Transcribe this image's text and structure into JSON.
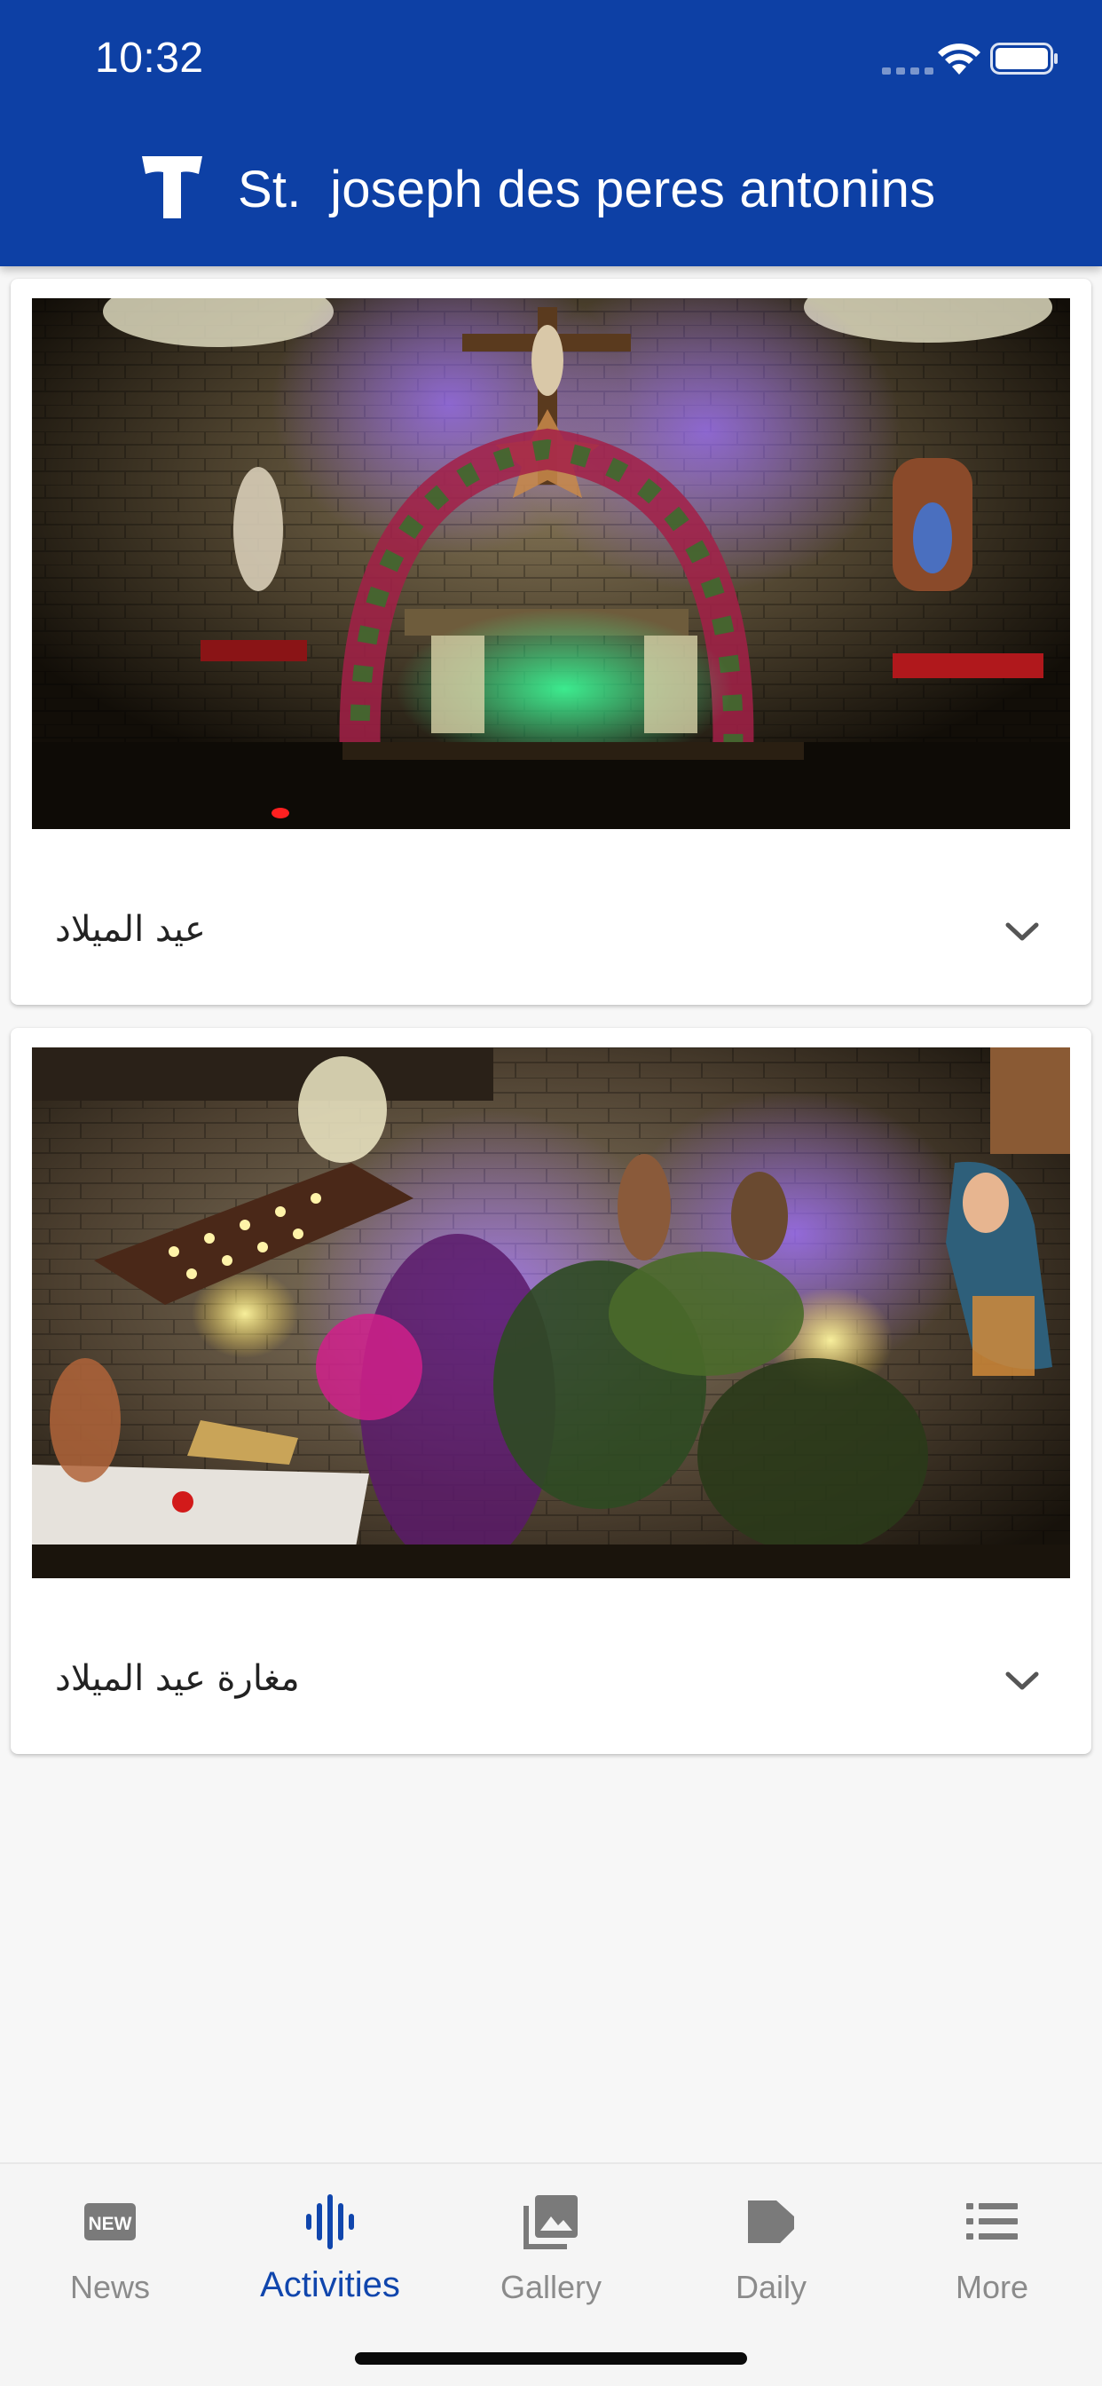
{
  "status_bar": {
    "time": "10:32",
    "icons": [
      "signal-icon",
      "wifi-icon",
      "battery-icon"
    ]
  },
  "app_bar": {
    "title": "St.  joseph des peres antonins",
    "logo_icon": "tau-cross-logo",
    "background": "#0d40a5"
  },
  "activities": [
    {
      "caption": "عيد الميلاد",
      "image": "church-altar-christmas-decorations",
      "toggle_icon": "chevron-down-icon"
    },
    {
      "caption": "مغارة عيد الميلاد",
      "image": "christmas-nativity-grotto",
      "toggle_icon": "chevron-down-icon"
    }
  ],
  "bottom_nav": {
    "active": "Activities",
    "accent": "#1046ad",
    "inactive_color": "#8b8b8b",
    "items": [
      {
        "label": "News",
        "icon": "new-badge-icon"
      },
      {
        "label": "Activities",
        "icon": "sound-wave-icon"
      },
      {
        "label": "Gallery",
        "icon": "photo-library-icon"
      },
      {
        "label": "Daily",
        "icon": "note-icon"
      },
      {
        "label": "More",
        "icon": "list-icon"
      }
    ]
  }
}
